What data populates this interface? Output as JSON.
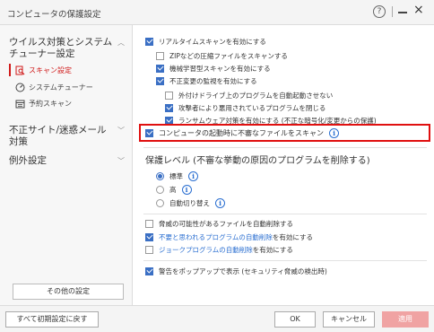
{
  "window": {
    "title": "コンピュータの保護設定",
    "help": "?",
    "close": "×"
  },
  "sidebar": {
    "section1": {
      "title_line1": "ウイルス対策とシステム",
      "title_line2": "チューナー設定",
      "chevron": "︿"
    },
    "items": [
      {
        "label": "スキャン設定",
        "icon": "search-doc-icon",
        "active": true
      },
      {
        "label": "システムチューナー",
        "icon": "gauge-icon",
        "active": false
      },
      {
        "label": "予約スキャン",
        "icon": "calendar-icon",
        "active": false
      }
    ],
    "section2": {
      "title_line1": "不正サイト/迷惑メール",
      "title_line2": "対策",
      "chevron": "﹀"
    },
    "section3": {
      "title": "例外設定",
      "chevron": "﹀"
    },
    "other_button": "その他の設定"
  },
  "main": {
    "options": [
      {
        "label": "リアルタイムスキャンを有効にする",
        "checked": true
      },
      {
        "label": "ZIPなどの圧縮ファイルをスキャンする",
        "checked": false
      },
      {
        "label": "機械学習型スキャンを有効にする",
        "checked": true
      },
      {
        "label": "不正変更の監視を有効にする",
        "checked": true
      },
      {
        "label": "外付けドライブ上のプログラムを自動起動させない",
        "checked": false
      },
      {
        "label": "攻撃者により悪用されているプログラムを閉じる",
        "checked": true
      },
      {
        "label": "ランサムウェア対策を有効にする (不正な暗号化/変更からの保護)",
        "checked": true
      },
      {
        "label": "コンピュータの起動時に不審なファイルをスキャン",
        "checked": true
      }
    ],
    "protection_level": {
      "title": "保護レベル (不審な挙動の原因のプログラムを削除する)",
      "levels": [
        {
          "label": "標準",
          "selected": true
        },
        {
          "label": "高",
          "selected": false
        },
        {
          "label": "自動切り替え",
          "selected": false
        }
      ]
    },
    "delete_options": [
      {
        "label": "脅威の可能性があるファイルを自動削除する",
        "checked": false,
        "blue": "",
        "rest": ""
      },
      {
        "label": "不要と思われるプログラムの自動削除",
        "rest": "を有効にする",
        "checked": true
      },
      {
        "label": "ジョークプログラムの自動削除",
        "rest": "を有効にする",
        "checked": false
      }
    ],
    "popup_option": {
      "label": "警告をポップアップで表示 (セキュリティ脅威の検出時)",
      "checked": true
    }
  },
  "footer": {
    "reset": "すべて初期設定に戻す",
    "ok": "OK",
    "cancel": "キャンセル",
    "apply": "適用"
  }
}
